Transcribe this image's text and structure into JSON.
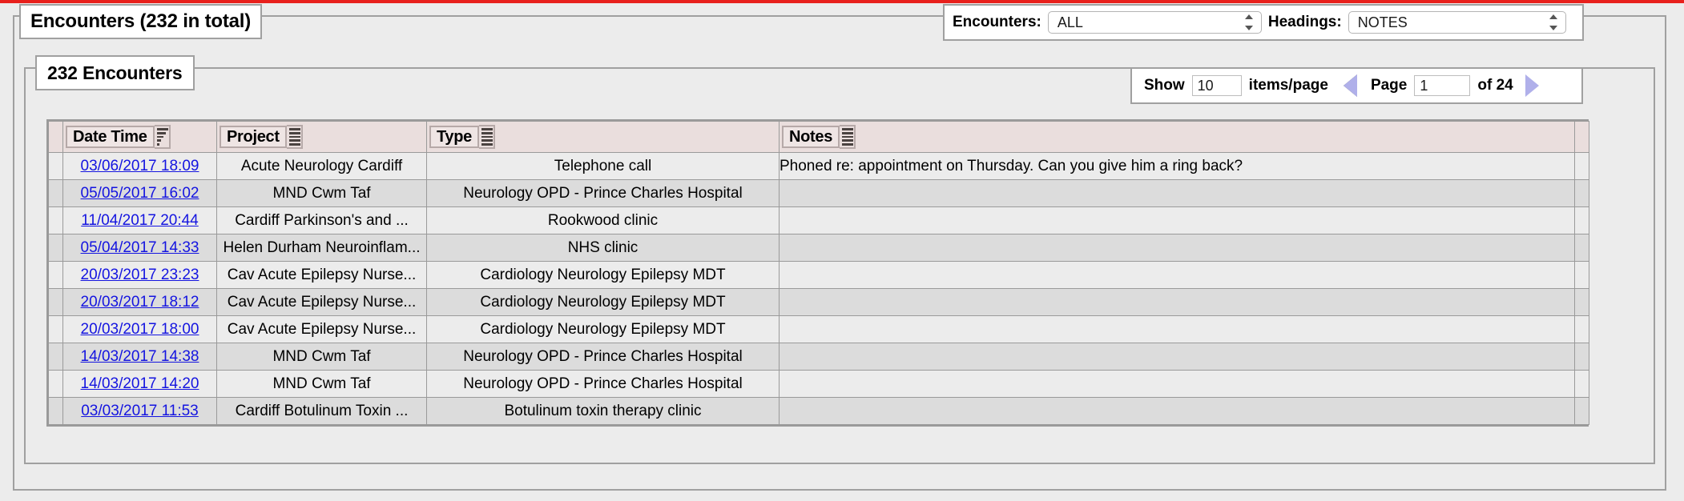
{
  "window": {
    "outer_legend": "Encounters (232 in total)",
    "inner_legend": "232 Encounters"
  },
  "filter_bar": {
    "encounters_label": "Encounters:",
    "encounters_value": "ALL",
    "headings_label": "Headings:",
    "headings_value": "NOTES"
  },
  "pager": {
    "show_label": "Show",
    "items_per_page": "10",
    "items_suffix": "items/page",
    "prev_icon": "triangle-left-icon",
    "page_label": "Page",
    "page_value": "1",
    "of_label": "of 24",
    "next_icon": "triangle-right-icon"
  },
  "table": {
    "columns": [
      {
        "label": "Date Time",
        "icon": "sort-descending-icon"
      },
      {
        "label": "Project",
        "icon": "column-menu-icon"
      },
      {
        "label": "Type",
        "icon": "column-menu-icon"
      },
      {
        "label": "Notes",
        "icon": "column-menu-icon"
      }
    ],
    "rows": [
      {
        "date_time": "03/06/2017 18:09",
        "project": "Acute Neurology Cardiff",
        "type": "Telephone call",
        "notes": "Phoned re: appointment on Thursday. Can you give him a ring back?"
      },
      {
        "date_time": "05/05/2017 16:02",
        "project": "MND Cwm Taf",
        "type": "Neurology OPD - Prince Charles Hospital",
        "notes": ""
      },
      {
        "date_time": "11/04/2017 20:44",
        "project": "Cardiff Parkinson's and ...",
        "type": "Rookwood clinic",
        "notes": ""
      },
      {
        "date_time": "05/04/2017 14:33",
        "project": "Helen Durham Neuroinflam...",
        "type": "NHS clinic",
        "notes": ""
      },
      {
        "date_time": "20/03/2017 23:23",
        "project": "Cav Acute Epilepsy Nurse...",
        "type": "Cardiology Neurology Epilepsy MDT",
        "notes": ""
      },
      {
        "date_time": "20/03/2017 18:12",
        "project": "Cav Acute Epilepsy Nurse...",
        "type": "Cardiology Neurology Epilepsy MDT",
        "notes": ""
      },
      {
        "date_time": "20/03/2017 18:00",
        "project": "Cav Acute Epilepsy Nurse...",
        "type": "Cardiology Neurology Epilepsy MDT",
        "notes": ""
      },
      {
        "date_time": "14/03/2017 14:38",
        "project": "MND Cwm Taf",
        "type": "Neurology OPD - Prince Charles Hospital",
        "notes": ""
      },
      {
        "date_time": "14/03/2017 14:20",
        "project": "MND Cwm Taf",
        "type": "Neurology OPD - Prince Charles Hospital",
        "notes": ""
      },
      {
        "date_time": "03/03/2017 11:53",
        "project": "Cardiff Botulinum Toxin ...",
        "type": "Botulinum toxin therapy clinic",
        "notes": ""
      }
    ]
  },
  "colors": {
    "accent_rule": "#e8201c",
    "header_bg": "#eadedd",
    "row_odd": "#ececec",
    "row_even": "#dcdcdc",
    "link": "#1414e0",
    "arrow_fill": "#b0b0ea"
  }
}
